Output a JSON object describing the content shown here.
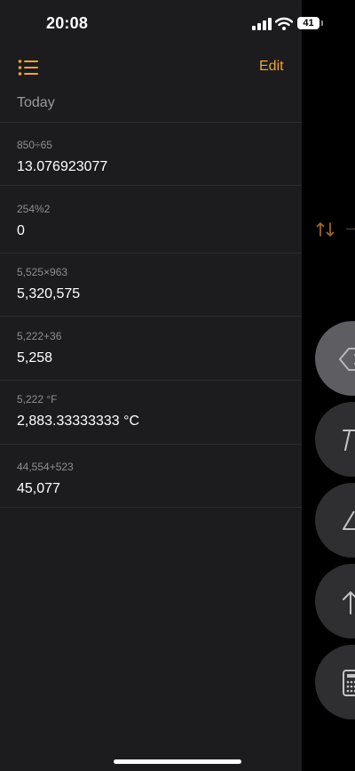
{
  "status_bar": {
    "time": "20:08",
    "battery": "41"
  },
  "header": {
    "edit_label": "Edit"
  },
  "history": {
    "section_title": "Today",
    "entries": [
      {
        "expression": "850÷65",
        "result": "13.076923077"
      },
      {
        "expression": "254%2",
        "result": "0"
      },
      {
        "expression": "5,525×963",
        "result": "5,320,575"
      },
      {
        "expression": "5,222+36",
        "result": "5,258"
      },
      {
        "expression": "5,222 °F",
        "result": "2,883.33333333 °C"
      },
      {
        "expression": "44,554+523",
        "result": "45,077"
      }
    ]
  },
  "colors": {
    "accent": "#f2a33a",
    "panel_background": "#1c1c1e",
    "secondary_text": "#8e8e93"
  },
  "icons": {
    "history_list": "list-icon",
    "swap_units": "swap-arrows-icon",
    "delete": "backspace-icon",
    "calculator_mode": "calculator-icon"
  }
}
